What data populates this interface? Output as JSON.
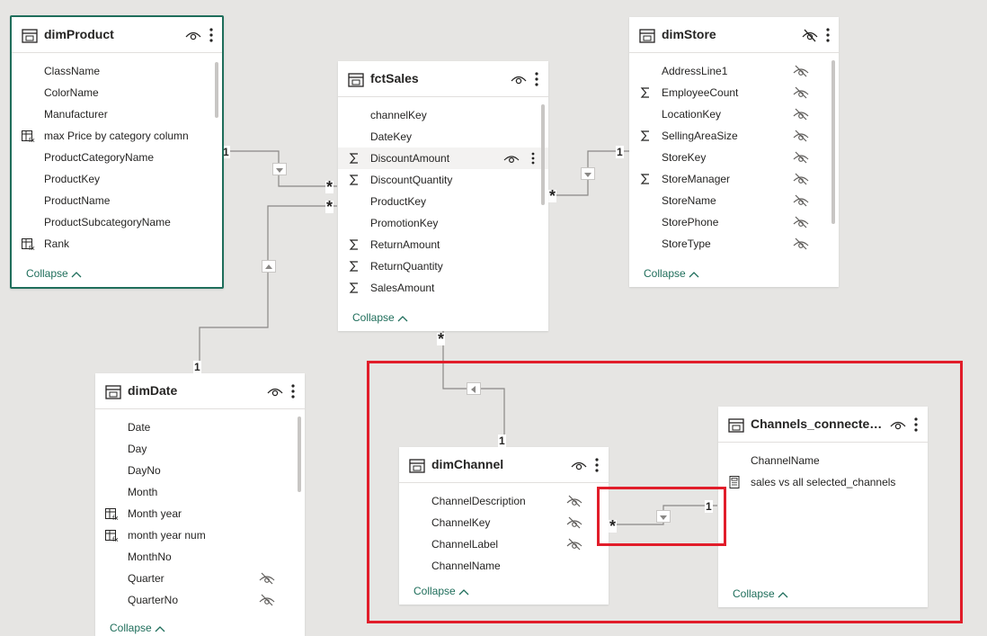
{
  "tables": {
    "dimProduct": {
      "title": "dimProduct",
      "fields": [
        "ClassName",
        "ColorName",
        "Manufacturer",
        "max Price by category column",
        "ProductCategoryName",
        "ProductKey",
        "ProductName",
        "ProductSubcategoryName",
        "Rank"
      ],
      "collapse": "Collapse"
    },
    "fctSales": {
      "title": "fctSales",
      "fields": [
        "channelKey",
        "DateKey",
        "DiscountAmount",
        "DiscountQuantity",
        "ProductKey",
        "PromotionKey",
        "ReturnAmount",
        "ReturnQuantity",
        "SalesAmount"
      ],
      "collapse": "Collapse"
    },
    "dimStore": {
      "title": "dimStore",
      "fields": [
        "AddressLine1",
        "EmployeeCount",
        "LocationKey",
        "SellingAreaSize",
        "StoreKey",
        "StoreManager",
        "StoreName",
        "StorePhone",
        "StoreType"
      ],
      "collapse": "Collapse"
    },
    "dimDate": {
      "title": "dimDate",
      "fields": [
        "Date",
        "Day",
        "DayNo",
        "Month",
        "Month year",
        "month year num",
        "MonthNo",
        "Quarter",
        "QuarterNo"
      ],
      "collapse": "Collapse"
    },
    "dimChannel": {
      "title": "dimChannel",
      "fields": [
        "ChannelDescription",
        "ChannelKey",
        "ChannelLabel",
        "ChannelName"
      ],
      "collapse": "Collapse"
    },
    "channelsConnected": {
      "title": "Channels_connected_...",
      "fields": [
        "ChannelName",
        "sales vs all selected_channels"
      ],
      "collapse": "Collapse"
    }
  },
  "relationships": {
    "one": "1",
    "many": "*"
  },
  "colors": {
    "accent": "#1f6e5b",
    "highlight": "#e11d2a",
    "canvas": "#e6e5e3"
  }
}
